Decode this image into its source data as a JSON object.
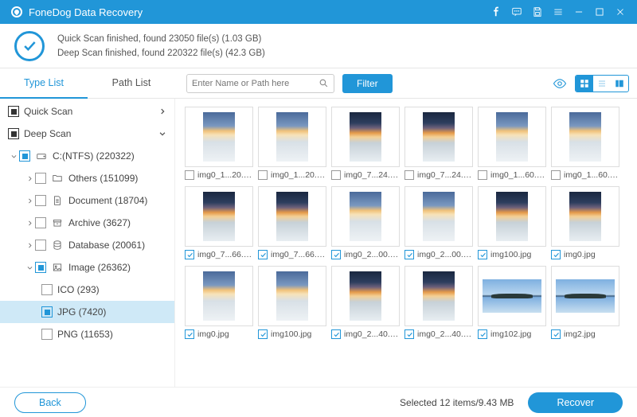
{
  "title": "FoneDog Data Recovery",
  "banner": {
    "line1": "Quick Scan finished, found 23050 file(s) (1.03 GB)",
    "line2": "Deep Scan finished, found 220322 file(s) (42.3 GB)"
  },
  "tabs": {
    "type_list": "Type List",
    "path_list": "Path List"
  },
  "search": {
    "placeholder": "Enter Name or Path here"
  },
  "filter_label": "Filter",
  "sidebar": {
    "quick_scan": "Quick Scan",
    "deep_scan": "Deep Scan",
    "drive": "C:(NTFS) (220322)",
    "others": "Others (151099)",
    "document": "Document (18704)",
    "archive": "Archive (3627)",
    "database": "Database (20061)",
    "image": "Image (26362)",
    "ico": "ICO (293)",
    "jpg": "JPG (7420)",
    "png": "PNG (11653)"
  },
  "files": [
    {
      "name": "img0_1...20.jpg",
      "checked": false,
      "variant": "a",
      "wide": false
    },
    {
      "name": "img0_1...20.jpg",
      "checked": false,
      "variant": "a",
      "wide": false
    },
    {
      "name": "img0_7...24.jpg",
      "checked": false,
      "variant": "b",
      "wide": false
    },
    {
      "name": "img0_7...24.jpg",
      "checked": false,
      "variant": "b",
      "wide": false
    },
    {
      "name": "img0_1...60.jpg",
      "checked": false,
      "variant": "a",
      "wide": false
    },
    {
      "name": "img0_1...60.jpg",
      "checked": false,
      "variant": "a",
      "wide": false
    },
    {
      "name": "img0_7...66.jpg",
      "checked": true,
      "variant": "b",
      "wide": false
    },
    {
      "name": "img0_7...66.jpg",
      "checked": true,
      "variant": "b",
      "wide": false
    },
    {
      "name": "img0_2...00.jpg",
      "checked": true,
      "variant": "a",
      "wide": false
    },
    {
      "name": "img0_2...00.jpg",
      "checked": true,
      "variant": "a",
      "wide": false
    },
    {
      "name": "img100.jpg",
      "checked": true,
      "variant": "b",
      "wide": false
    },
    {
      "name": "img0.jpg",
      "checked": true,
      "variant": "b",
      "wide": false
    },
    {
      "name": "img0.jpg",
      "checked": true,
      "variant": "a",
      "wide": false
    },
    {
      "name": "img100.jpg",
      "checked": true,
      "variant": "a",
      "wide": false
    },
    {
      "name": "img0_2...40.jpg",
      "checked": true,
      "variant": "b",
      "wide": false
    },
    {
      "name": "img0_2...40.jpg",
      "checked": true,
      "variant": "b",
      "wide": false
    },
    {
      "name": "img102.jpg",
      "checked": true,
      "variant": "r",
      "wide": true
    },
    {
      "name": "img2.jpg",
      "checked": true,
      "variant": "r",
      "wide": true
    }
  ],
  "footer": {
    "back": "Back",
    "recover": "Recover",
    "status": "Selected 12 items/9.43 MB"
  }
}
